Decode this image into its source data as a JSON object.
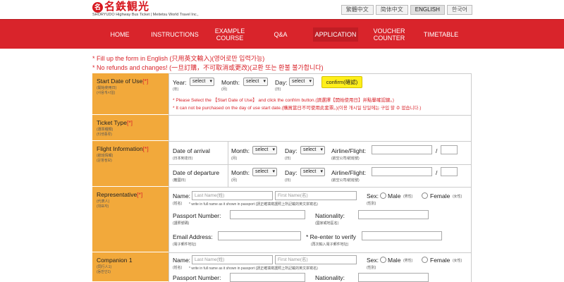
{
  "brand": {
    "logo_mark": "名",
    "logo_text": "名鉄観光",
    "subtitle": "SHORYUDO Highway Bus Ticket | Meitetsu World Travel Inc.,"
  },
  "languages": [
    {
      "label": "繁體中文",
      "active": false
    },
    {
      "label": "简体中文",
      "active": false
    },
    {
      "label": "ENGLISH",
      "active": true
    },
    {
      "label": "한국어",
      "active": false
    }
  ],
  "nav": [
    {
      "label": "HOME"
    },
    {
      "label": "INSTRUCTIONS"
    },
    {
      "label": "EXAMPLE\nCOURSE"
    },
    {
      "label": "Q&A"
    },
    {
      "label": "APPLICATION"
    },
    {
      "label": "VOUCHER\nCOUNTER"
    },
    {
      "label": "TIMETABLE"
    }
  ],
  "notices": {
    "english_only": "* Fill up the form in English (只用英文輸入)(영어로만 입력가능)",
    "no_refunds": "* No refunds and changes! (一旦訂購，不可取消或更改)(교환 또는 환불 불가합니다)"
  },
  "start_date": {
    "label": "Start Date of Use",
    "req": "[*]",
    "sub1": "(開始使用日)",
    "sub2": "(사용개시일)",
    "year_label": "Year:",
    "year_sub": "(年)",
    "month_label": "Month:",
    "month_sub": "(月)",
    "day_label": "Day:",
    "day_sub": "(日)",
    "select": "select",
    "confirm": "confirm(確認)",
    "note1": "* Please Select the 【Start Date of Use】 and click the confrim button.(請選擇【開始使用日】并點擊確認鍵。)",
    "note2": "* It can not be purchased on the day of use start date.(購買當日不可使用此套票。)(이용 개시일 당일에는 구입 할 수 없습니다.)"
  },
  "ticket_type": {
    "label": "Ticket Type",
    "req": "[*]",
    "sub1": "(選票種類)",
    "sub2": "(티켓종류)"
  },
  "flight": {
    "label": "Flight Information",
    "req": "[*]",
    "sub1": "(航班情報)",
    "sub2": "(운항정보)",
    "arrival": "Date of arrival",
    "arrival_sub": "(日本到達日)",
    "departure": "Date of departure",
    "departure_sub": "(離國日)",
    "month_label": "Month:",
    "month_sub": "(月)",
    "day_label": "Day:",
    "day_sub": "(日)",
    "select": "select",
    "airline_label": "Airline/Flight:",
    "airline_sub": "(航空公司/航班號)",
    "slash": "/"
  },
  "representative": {
    "label": "Representative",
    "req": "[*]",
    "sub1": "(代表人)",
    "sub2": "(대표자)",
    "name_label": "Name:",
    "name_sub": "(姓名)",
    "last_placeholder": "Last Name(姓)",
    "first_placeholder": "First Name(名)",
    "name_note": "* write in full name as it shown in passport (請正確填寫護照上所記載的英文拼寫名)",
    "sex_label": "Sex:",
    "sex_sub": "(性別)",
    "male": "Male",
    "male_sub": "(男性)",
    "female": "Female",
    "female_sub": "(女性)",
    "passport_label": "Passport Number:",
    "passport_sub": "(護照號碼)",
    "nationality_label": "Nationality:",
    "nationality_sub": "(國家或地區名)",
    "email_label": "Email Address:",
    "email_sub": "(電子郵件地址)",
    "reenter_label": "* Re-enter to verify",
    "reenter_sub": "(再次輸入電子郵件地址)"
  },
  "companion1": {
    "label": "Companion 1",
    "sub1": "(同行人1)",
    "sub2": "(동반인1)",
    "name_label": "Name:",
    "name_sub": "(姓名)",
    "last_placeholder": "Last Name(姓)",
    "first_placeholder": "First Name(名)",
    "name_note": "* write in full name as it shown in passport (請正確填寫護照上所記載的英文拼寫名)",
    "sex_label": "Sex:",
    "sex_sub": "(性別)",
    "male": "Male",
    "male_sub": "(男性)",
    "female": "Female",
    "female_sub": "(女性)",
    "passport_label": "Passport Number:",
    "nationality_label": "Nationality:"
  },
  "colors": {
    "nav": "#d9242b",
    "label_bg": "#f2a93b",
    "accent": "#d9242b",
    "confirm_bg": "#ffef1a"
  }
}
